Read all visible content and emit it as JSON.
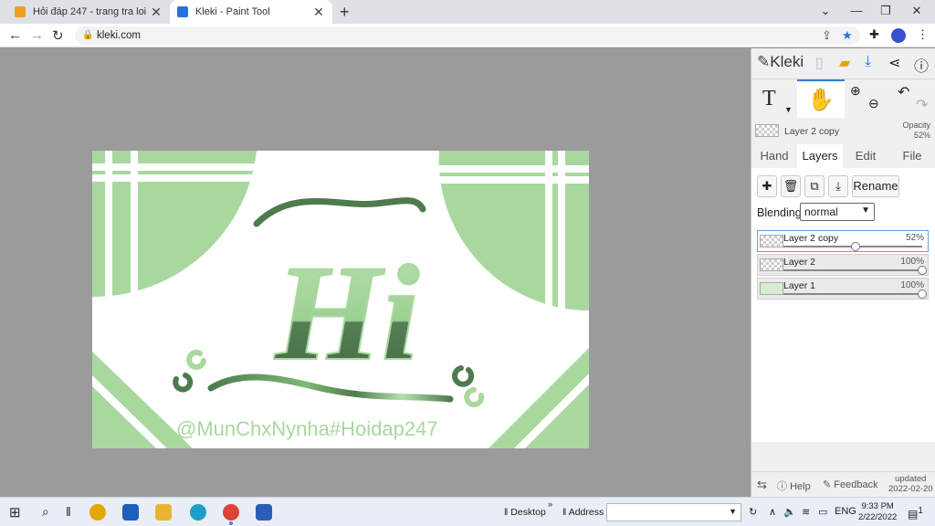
{
  "browser": {
    "tabs": [
      {
        "title": "Hỏi đáp 247 - trang tra loi",
        "favicon_color": "#f0a020"
      },
      {
        "title": "Kleki - Paint Tool",
        "favicon_color": "#2a6fe0"
      }
    ],
    "url": "kleki.com"
  },
  "app": {
    "logo": "Kleki",
    "current_layer": "Layer 2 copy",
    "opacity_label": "Opacity",
    "opacity_value": "52%",
    "panel_tabs": [
      "Hand",
      "Layers",
      "Edit",
      "File"
    ],
    "active_tab": "Layers",
    "rename_label": "Rename",
    "blending_label": "Blending",
    "blending_value": "normal",
    "layers": [
      {
        "name": "Layer 2 copy",
        "opacity": "52%",
        "opacity_fraction": 0.52
      },
      {
        "name": "Layer 2",
        "opacity": "100%",
        "opacity_fraction": 1.0
      },
      {
        "name": "Layer 1",
        "opacity": "100%",
        "opacity_fraction": 1.0
      }
    ],
    "footer": {
      "help": "Help",
      "feedback": "Feedback",
      "updated_label": "updated",
      "updated_date": "2022-02-20"
    }
  },
  "artwork": {
    "main_text": "Hi",
    "watermark": "@MunChxNynha#Hoidap247",
    "colors": {
      "light_green": "#a8d89e",
      "dark_green": "#4e7a4e"
    }
  },
  "taskbar": {
    "desktop_label": "Desktop",
    "address_label": "Address",
    "language": "ENG",
    "time": "9:33 PM",
    "date": "2/22/2022",
    "notifications": "1"
  }
}
